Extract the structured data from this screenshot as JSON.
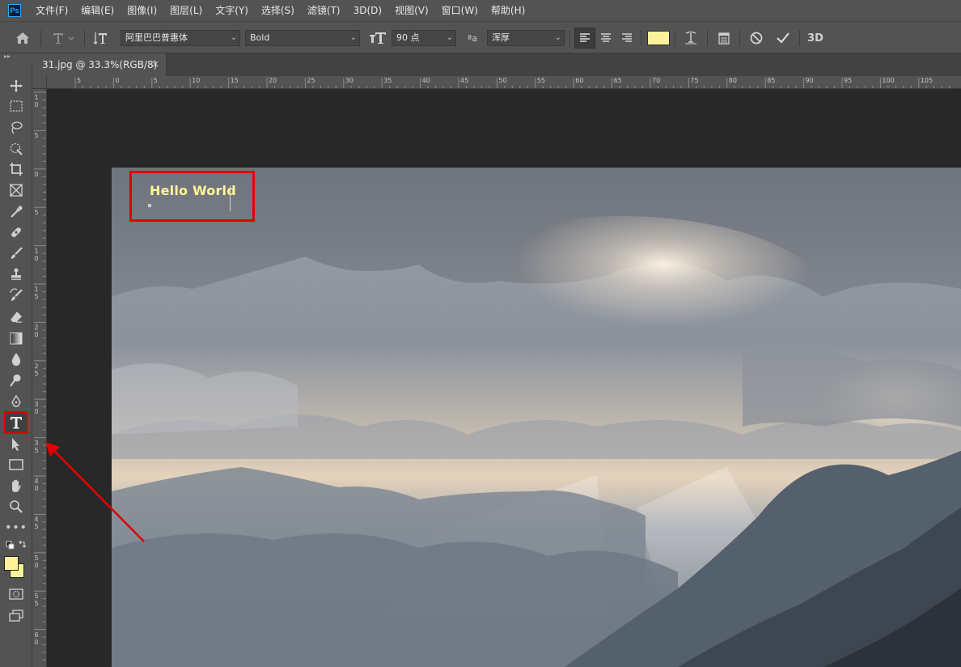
{
  "app": {
    "logo_text": "Ps"
  },
  "menu": [
    "文件(F)",
    "编辑(E)",
    "图像(I)",
    "图层(L)",
    "文字(Y)",
    "选择(S)",
    "滤镜(T)",
    "3D(D)",
    "视图(V)",
    "窗口(W)",
    "帮助(H)"
  ],
  "options": {
    "font_family": "阿里巴巴普惠体",
    "font_style": "Bold",
    "font_size": "90 点",
    "antialias_glyph": "ªa",
    "antialias": "浑厚",
    "text_color": "#fdf29b",
    "three_d_label": "3D"
  },
  "toolhead": {
    "collapse_glyph": "▸▸"
  },
  "tab": {
    "title": "31.jpg @ 33.3%(RGB/8)",
    "close_glyph": "×"
  },
  "ruler_h": [
    "5",
    "0",
    "5",
    "10",
    "15",
    "20",
    "25",
    "30",
    "35",
    "40",
    "45",
    "50",
    "55",
    "60",
    "65",
    "70",
    "75",
    "80",
    "85",
    "90",
    "95",
    "100",
    "105"
  ],
  "ruler_v": [
    "1 0",
    "5",
    "0",
    "5",
    "1 0",
    "1 5",
    "2 0",
    "2 5",
    "3 0",
    "3 5",
    "4 0",
    "4 5",
    "5 0",
    "5 5",
    "6 0"
  ],
  "canvas": {
    "text_layer": "Hello World"
  },
  "colors": {
    "foreground": "#fdf29b",
    "background": "#fdf29b",
    "annotation": "#e30000"
  }
}
